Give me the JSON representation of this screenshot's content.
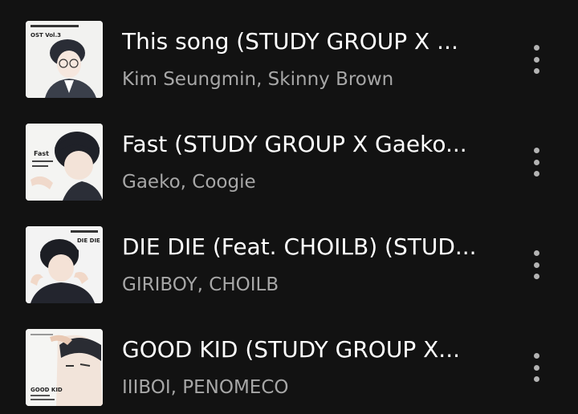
{
  "tracks": [
    {
      "title": "This song (STUDY GROUP X ...",
      "artists": "Kim Seungmin, Skinny Brown",
      "cover_text": "OST Vol.3",
      "icon": "more-options-icon"
    },
    {
      "title": "Fast (STUDY GROUP X Gaeko...",
      "artists": "Gaeko, Coogie",
      "cover_text": "Fast",
      "icon": "more-options-icon"
    },
    {
      "title": "DIE DIE (Feat. CHOILB) (STUD...",
      "artists": "GIRIBOY, CHOILB",
      "cover_text": "DIE DIE",
      "icon": "more-options-icon"
    },
    {
      "title": "GOOD KID (STUDY GROUP X...",
      "artists": "IIIBOI, PENOMECO",
      "cover_text": "GOOD KID",
      "icon": "more-options-icon"
    }
  ]
}
